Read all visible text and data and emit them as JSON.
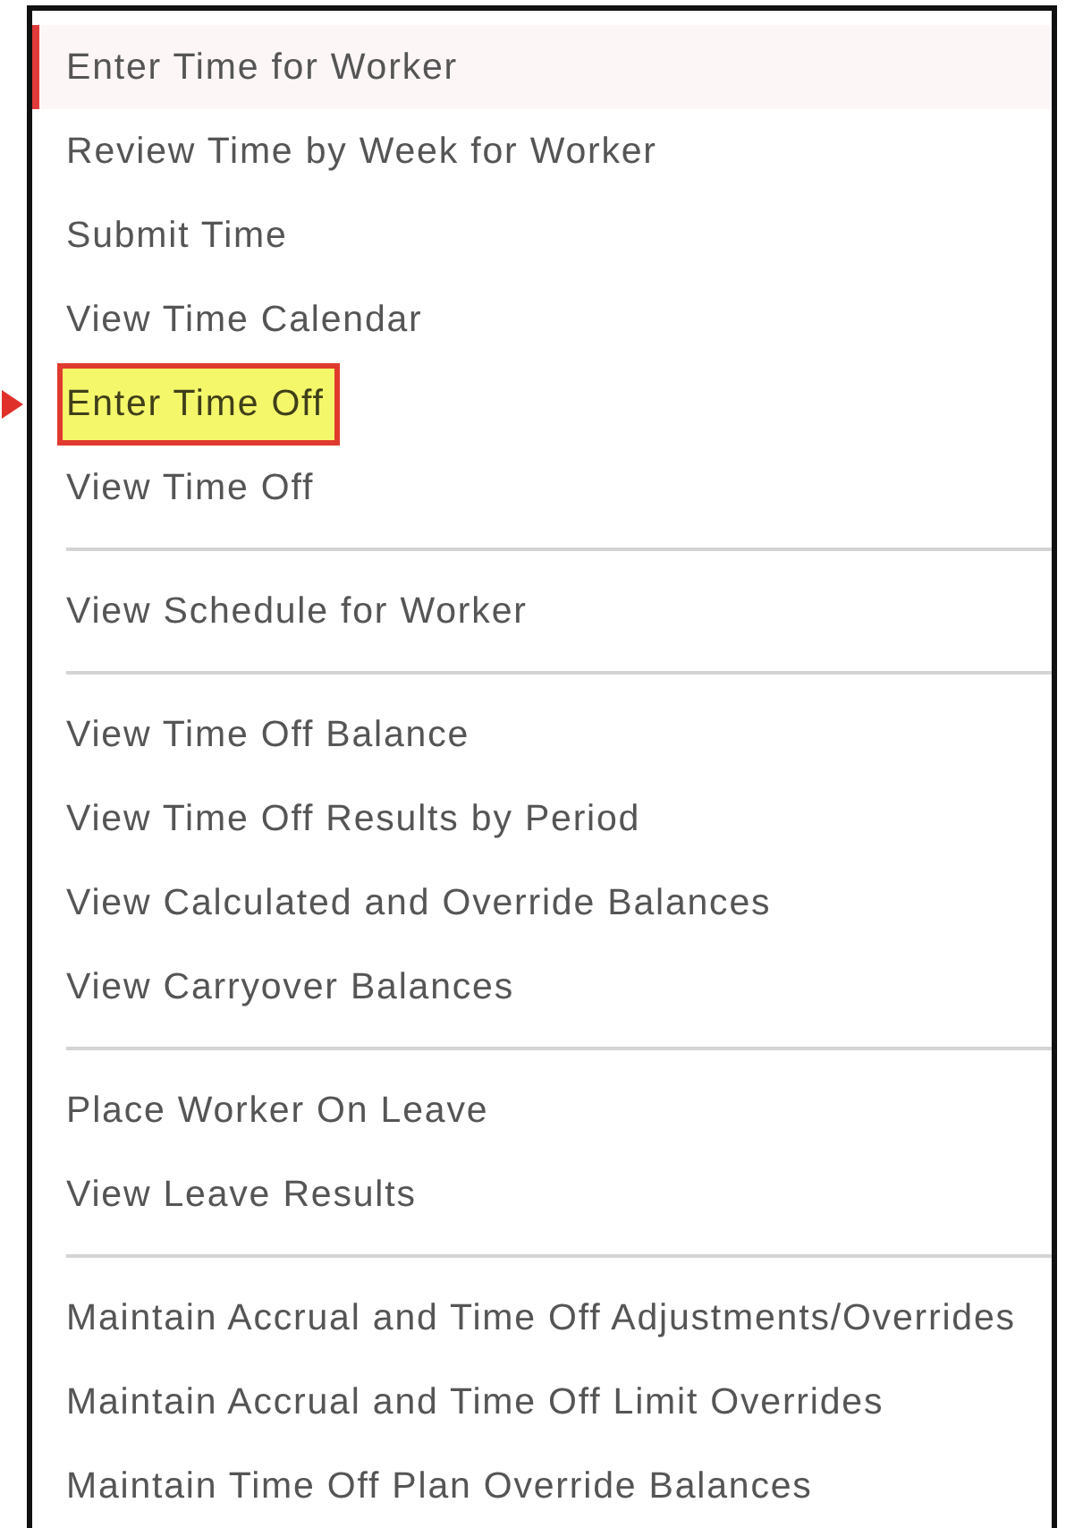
{
  "menu": {
    "groups": [
      {
        "items": [
          {
            "label": "Enter Time for Worker",
            "current": true,
            "highlighted": false
          },
          {
            "label": "Review Time by Week for Worker",
            "current": false,
            "highlighted": false
          },
          {
            "label": "Submit Time",
            "current": false,
            "highlighted": false
          },
          {
            "label": "View Time Calendar",
            "current": false,
            "highlighted": false
          },
          {
            "label": "Enter Time Off",
            "current": false,
            "highlighted": true
          },
          {
            "label": "View Time Off",
            "current": false,
            "highlighted": false
          }
        ]
      },
      {
        "items": [
          {
            "label": "View Schedule for Worker",
            "current": false,
            "highlighted": false
          }
        ]
      },
      {
        "items": [
          {
            "label": "View Time Off Balance",
            "current": false,
            "highlighted": false
          },
          {
            "label": "View Time Off Results by Period",
            "current": false,
            "highlighted": false
          },
          {
            "label": "View Calculated and Override Balances",
            "current": false,
            "highlighted": false
          },
          {
            "label": "View Carryover Balances",
            "current": false,
            "highlighted": false
          }
        ]
      },
      {
        "items": [
          {
            "label": "Place Worker On Leave",
            "current": false,
            "highlighted": false
          },
          {
            "label": "View Leave Results",
            "current": false,
            "highlighted": false
          }
        ]
      },
      {
        "items": [
          {
            "label": "Maintain Accrual and Time Off Adjustments/Overrides",
            "current": false,
            "highlighted": false
          },
          {
            "label": "Maintain Accrual and Time Off Limit Overrides",
            "current": false,
            "highlighted": false
          },
          {
            "label": "Maintain Time Off Plan Override Balances",
            "current": false,
            "highlighted": false
          }
        ]
      }
    ]
  }
}
